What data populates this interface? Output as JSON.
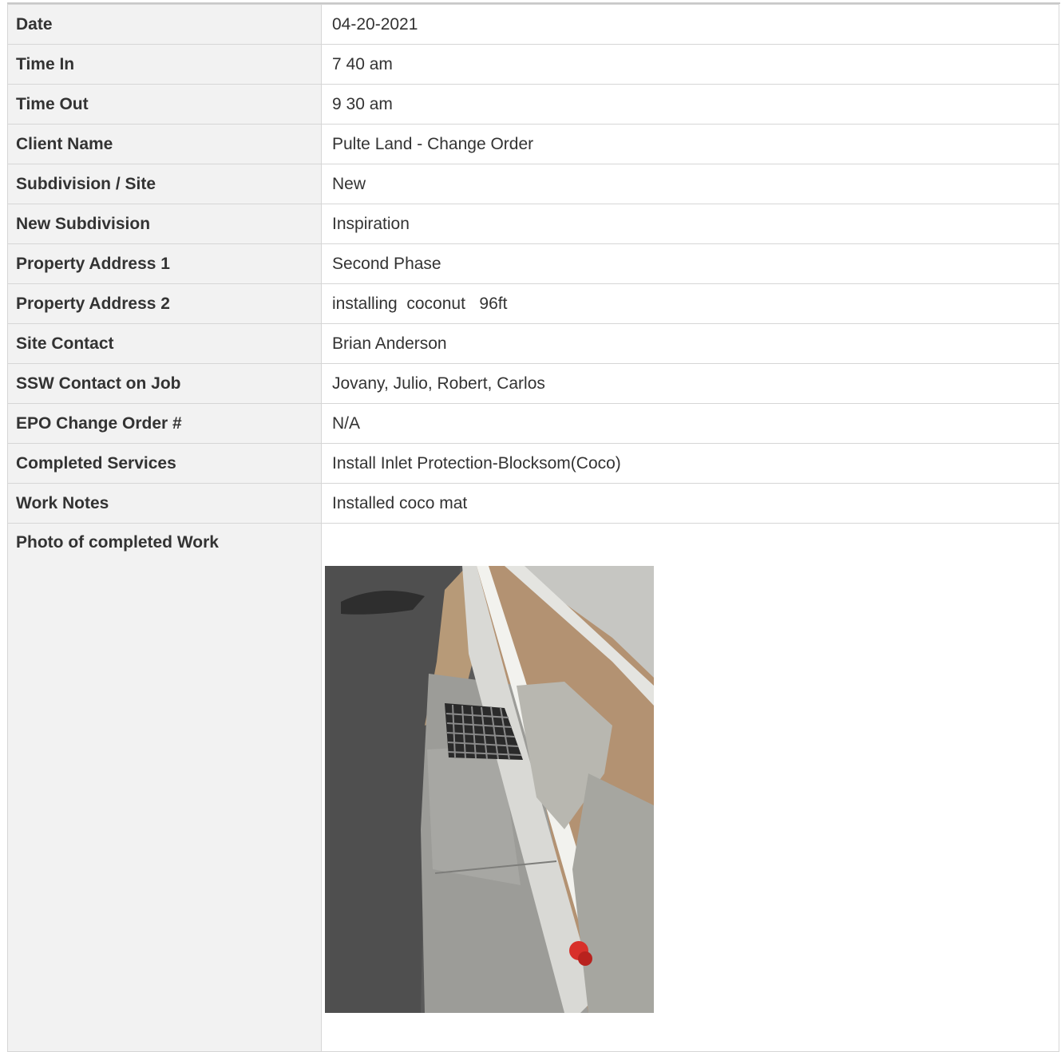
{
  "rows": [
    {
      "label": "Date",
      "value": "04-20-2021"
    },
    {
      "label": "Time In",
      "value": "7 40 am"
    },
    {
      "label": "Time Out",
      "value": "9 30 am"
    },
    {
      "label": "Client Name",
      "value": "Pulte Land - Change Order"
    },
    {
      "label": "Subdivision / Site",
      "value": "New"
    },
    {
      "label": "New Subdivision",
      "value": "Inspiration"
    },
    {
      "label": "Property Address 1",
      "value": "Second Phase"
    },
    {
      "label": "Property Address 2",
      "value": "installing  coconut   96ft"
    },
    {
      "label": "Site Contact",
      "value": "Brian Anderson"
    },
    {
      "label": "SSW  Contact on Job",
      "value": "Jovany, Julio, Robert, Carlos"
    },
    {
      "label": "EPO Change Order #",
      "value": "N/A"
    },
    {
      "label": "Completed Services",
      "value": "Install Inlet Protection-Blocksom(Coco)"
    },
    {
      "label": "Work Notes",
      "value": "Installed coco mat"
    }
  ],
  "photo": {
    "label": "Photo of completed Work"
  }
}
